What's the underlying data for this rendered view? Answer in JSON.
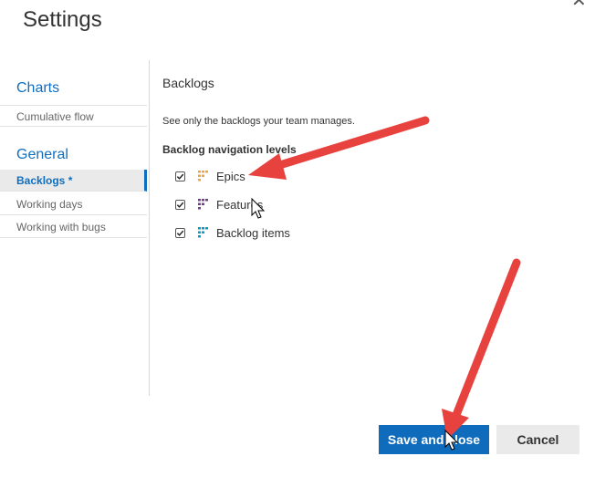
{
  "dialog": {
    "title": "Settings",
    "close_icon": "close-icon"
  },
  "sidebar": {
    "sections": [
      {
        "heading": "Charts",
        "items": [
          {
            "label": "Cumulative flow"
          }
        ]
      },
      {
        "heading": "General",
        "items": [
          {
            "label": "Backlogs *",
            "selected": true
          },
          {
            "label": "Working days"
          },
          {
            "label": "Working with bugs"
          }
        ]
      }
    ]
  },
  "content": {
    "title": "Backlogs",
    "description": "See only the backlogs your team manages.",
    "levels_heading": "Backlog navigation levels",
    "levels": [
      {
        "label": "Epics",
        "checked": true,
        "icon": "epic-icon",
        "color": "#f2a33a"
      },
      {
        "label": "Features",
        "checked": true,
        "icon": "feature-icon",
        "color": "#773b93"
      },
      {
        "label": "Backlog items",
        "checked": true,
        "icon": "backlog-item-icon",
        "color": "#009ccc"
      }
    ]
  },
  "footer": {
    "save_label": "Save and close",
    "cancel_label": "Cancel"
  },
  "colors": {
    "accent": "#0f6cbd",
    "annotation_arrow": "#e8423f"
  }
}
